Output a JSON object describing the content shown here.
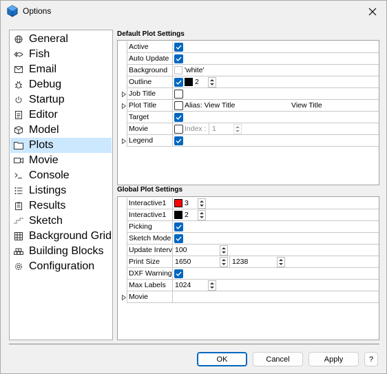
{
  "window": {
    "title": "Options"
  },
  "sidebar": {
    "items": [
      {
        "label": "General",
        "icon": "globe-icon"
      },
      {
        "label": "Fish",
        "icon": "fish-icon"
      },
      {
        "label": "Email",
        "icon": "envelope-icon"
      },
      {
        "label": "Debug",
        "icon": "bug-icon"
      },
      {
        "label": "Startup",
        "icon": "power-icon"
      },
      {
        "label": "Editor",
        "icon": "document-icon"
      },
      {
        "label": "Model",
        "icon": "cube-icon"
      },
      {
        "label": "Plots",
        "icon": "folder-icon",
        "selected": true
      },
      {
        "label": "Movie",
        "icon": "video-camera-icon"
      },
      {
        "label": "Console",
        "icon": "terminal-icon"
      },
      {
        "label": "Listings",
        "icon": "list-icon"
      },
      {
        "label": "Results",
        "icon": "clipboard-icon"
      },
      {
        "label": "Sketch",
        "icon": "sketch-icon"
      },
      {
        "label": "Background Grid",
        "icon": "grid-icon"
      },
      {
        "label": "Building Blocks",
        "icon": "blocks-icon"
      },
      {
        "label": "Configuration",
        "icon": "gear-icon"
      }
    ]
  },
  "default_plot": {
    "title": "Default Plot Settings",
    "rows": {
      "active": {
        "label": "Active",
        "checked": true
      },
      "auto_update": {
        "label": "Auto Update",
        "checked": true
      },
      "background": {
        "label": "Background",
        "value": "'white'",
        "color": "#ffffff"
      },
      "outline": {
        "label": "Outline",
        "checked": true,
        "color": "#000000",
        "width": "2"
      },
      "job_title": {
        "label": "Job Title",
        "checked": false
      },
      "plot_title": {
        "label": "Plot Title",
        "checked": false,
        "alias_label": "Alias: View Title",
        "value": "View Title"
      },
      "target": {
        "label": "Target",
        "checked": true
      },
      "movie": {
        "label": "Movie",
        "checked": false,
        "index_label": "Index :",
        "index_value": "1"
      },
      "legend": {
        "label": "Legend",
        "checked": true
      }
    }
  },
  "global_plot": {
    "title": "Global Plot Settings",
    "rows": {
      "interactive1": {
        "label": "Interactive1",
        "color": "#ff0000",
        "value": "3"
      },
      "interactive2": {
        "label": "Interactive1",
        "color": "#000000",
        "value": "2"
      },
      "picking": {
        "label": "Picking",
        "checked": true
      },
      "sketch_mode": {
        "label": "Sketch Mode",
        "checked": true
      },
      "update_interval": {
        "label": "Update Interv",
        "value": "100"
      },
      "print_size": {
        "label": "Print Size",
        "width": "1650",
        "height": "1238"
      },
      "dxf_warning": {
        "label": "DXF Warning",
        "checked": true
      },
      "max_labels": {
        "label": "Max Labels",
        "value": "1024"
      },
      "movie": {
        "label": "Movie"
      }
    }
  },
  "buttons": {
    "ok": "OK",
    "cancel": "Cancel",
    "apply": "Apply",
    "help": "?"
  },
  "colors": {
    "accent": "#0067c0",
    "selection": "#cce8ff"
  }
}
